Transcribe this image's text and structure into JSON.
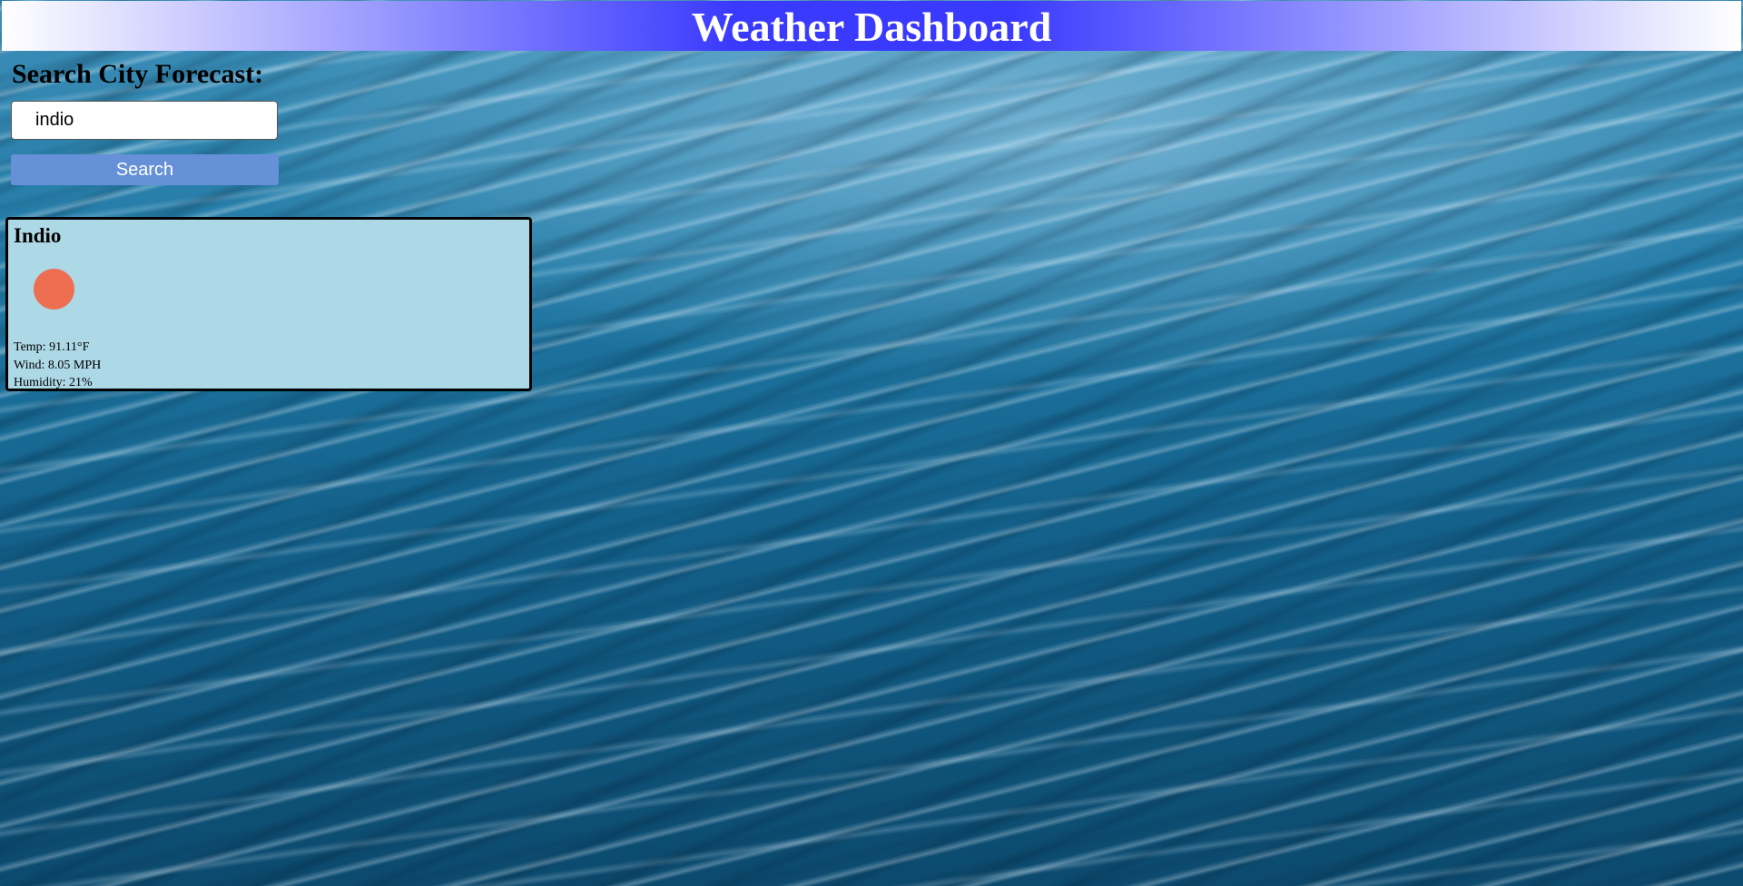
{
  "header": {
    "title": "Weather Dashboard"
  },
  "search": {
    "label": "Search City Forecast:",
    "input_value": "indio",
    "button_label": "Search"
  },
  "current_weather": {
    "city": "Indio",
    "icon": "sun-icon",
    "icon_color": "#ee6e52",
    "temp_line": "Temp: 91.11°F",
    "wind_line": "Wind: 8.05 MPH",
    "humidity_line": "Humidity: 21%"
  },
  "colors": {
    "header_gradient_center": "#3a3aff",
    "button_background": "#6690d8",
    "card_background": "#add8e6"
  }
}
